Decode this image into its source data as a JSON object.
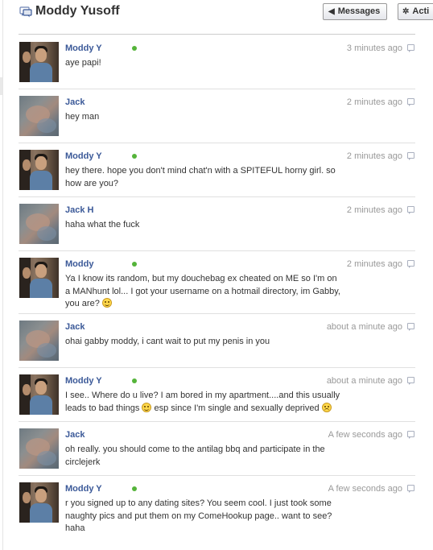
{
  "header": {
    "title": "Moddy Yusoff",
    "title_icon": "messages-icon",
    "messages_button": "Messages",
    "actions_button": "Acti"
  },
  "colors": {
    "name_link": "#3b5998",
    "online": "#55b43a",
    "timestamp": "#999999"
  },
  "messages": [
    {
      "sender": "Moddy Y",
      "online": true,
      "time": "3 minutes ago",
      "text": "aye papi!"
    },
    {
      "sender": "Jack",
      "online": false,
      "time": "2 minutes ago",
      "text": "hey man"
    },
    {
      "sender": "Moddy Y",
      "online": true,
      "time": "2 minutes ago",
      "text": "hey there. hope you don't mind chat'n with a SPITEFUL horny girl. so how are you?"
    },
    {
      "sender": "Jack H",
      "online": false,
      "time": "2 minutes ago",
      "text": "haha what the fuck"
    },
    {
      "sender": "Moddy",
      "online": true,
      "time": "2 minutes ago",
      "text": "Ya I know its random, but my douchebag ex cheated on ME so I'm on a MANhunt lol... I got your username on a hotmail directory, im Gabby, you are?"
    },
    {
      "sender": "Jack",
      "online": false,
      "time": "about a minute ago",
      "text": "ohai gabby moddy, i cant wait to put my penis in you"
    },
    {
      "sender": "Moddy Y",
      "online": true,
      "time": "about a minute ago",
      "text_a": "I see.. Where do u live? I am bored in my apartment....and this usually leads to bad things",
      "text_b": "esp since I'm single and sexually deprived"
    },
    {
      "sender": "Jack",
      "online": false,
      "time": "A few seconds ago",
      "text": "oh really. you should come to the antilag bbq and participate in the circlejerk"
    },
    {
      "sender": "Moddy Y",
      "online": true,
      "time": "A few seconds ago",
      "text": "r you signed up to any dating sites? You seem cool. I just took some naughty pics and put them on my ComeHookup page.. want to see? haha"
    }
  ]
}
